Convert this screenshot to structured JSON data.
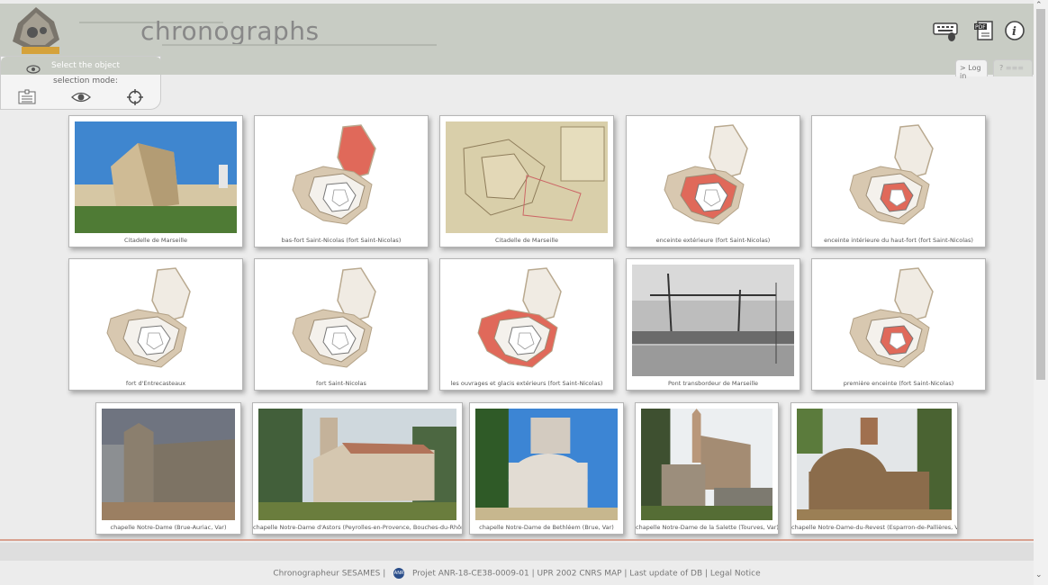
{
  "header": {
    "title": "chronographs",
    "logo_text": "SESAMES",
    "keyboard_icon": "keyboard-mouse-icon",
    "pdf_icon": "pdf-document-icon",
    "info_icon": "info-icon",
    "login_tab": "> Log in",
    "help_tab": "?"
  },
  "selection": {
    "title": "Select the object",
    "mode_label": "selection mode:",
    "modes": [
      "list-icon",
      "eye-icon",
      "crosshair-icon"
    ]
  },
  "cards": [
    {
      "caption": "Citadelle de Marseille",
      "kind": "photo-fort"
    },
    {
      "caption": "bas-fort Saint-Nicolas (fort Saint-Nicolas)",
      "kind": "plan-top"
    },
    {
      "caption": "Citadelle de Marseille",
      "kind": "old-map"
    },
    {
      "caption": "enceinte extérieure (fort Saint-Nicolas)",
      "kind": "plan-mid"
    },
    {
      "caption": "enceinte intérieure du haut-fort (fort Saint-Nicolas)",
      "kind": "plan-inner"
    },
    {
      "caption": "fort d'Entrecasteaux",
      "kind": "plan-beige"
    },
    {
      "caption": "fort Saint-Nicolas",
      "kind": "plan-plain"
    },
    {
      "caption": "les ouvrages et glacis extérieurs (fort Saint-Nicolas)",
      "kind": "plan-outer"
    },
    {
      "caption": "Pont transbordeur de Marseille",
      "kind": "photo-bridge"
    },
    {
      "caption": "première enceinte (fort Saint-Nicolas)",
      "kind": "plan-first"
    },
    {
      "caption": "chapelle Notre-Dame (Brue-Auriac, Var)",
      "kind": "photo-chapel1"
    },
    {
      "caption": "chapelle Notre-Dame d'Astors (Peyrolles-en-Provence, Bouches-du-Rhône)",
      "kind": "photo-chapel2"
    },
    {
      "caption": "chapelle Notre-Dame de Bethléem (Brue, Var)",
      "kind": "photo-chapel3"
    },
    {
      "caption": "chapelle Notre-Dame de la Salette (Tourves, Var)",
      "kind": "photo-chapel4"
    },
    {
      "caption": "chapelle Notre-Dame-du-Revest (Esparron-de-Pallières, Var)",
      "kind": "photo-chapel5"
    }
  ],
  "footer": {
    "left": "Chronographeur SESAMES |",
    "badge": "ANR",
    "right": "Projet ANR-18-CE38-0009-01 | UPR 2002 CNRS MAP | Last update of DB | Legal Notice"
  },
  "colors": {
    "header_bg": "#c8ccc4",
    "highlight_red": "#e0695a",
    "plan_beige": "#d8c8b0",
    "footer_line": "#d9a190"
  }
}
